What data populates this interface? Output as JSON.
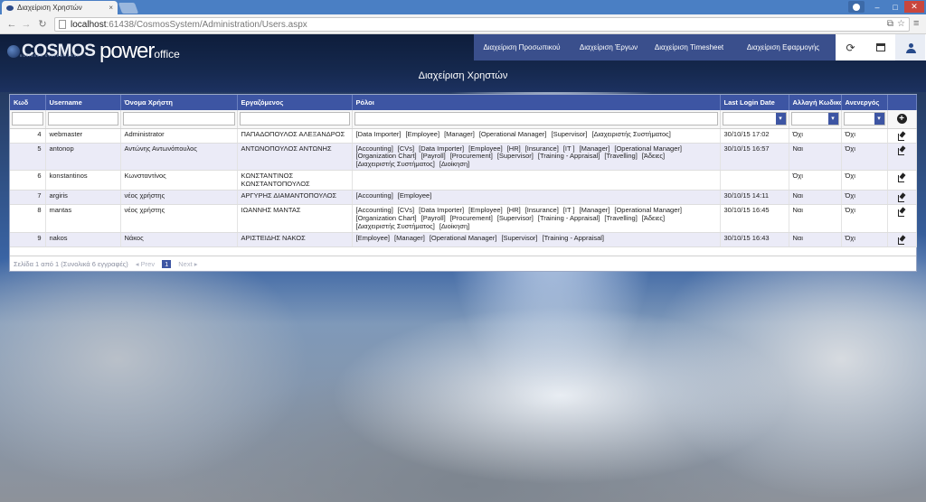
{
  "browser": {
    "tab_title": "Διαχείριση Χρηστών",
    "tab_close": "×",
    "url_host": "localhost",
    "url_rest": ":61438/CosmosSystem/Administration/Users.aspx",
    "win_min": "–",
    "win_max": "□",
    "win_close": "✕",
    "nav_back": "←",
    "nav_forward": "→",
    "nav_reload": "↻",
    "translate": "⧉",
    "star": "☆",
    "menu": "≡"
  },
  "brand": {
    "cosmos": "COSMOS",
    "cosmos_sub": "BUSINESS SYSTEMS AEBE",
    "power": "power",
    "office": "office"
  },
  "nav": {
    "items": [
      {
        "label": "Διαχείριση Προσωπικού"
      },
      {
        "label": "Διαχείριση Έργων"
      },
      {
        "label": "Διαχείριση Timesheet"
      },
      {
        "label": "Διαχείριση Εφαρμογής"
      }
    ],
    "refresh_icon": "⟳"
  },
  "page": {
    "title": "Διαχείριση Χρηστών"
  },
  "grid": {
    "columns": {
      "id": "Κωδ",
      "username": "Username",
      "display_name": "Όνομα Χρήστη",
      "employee": "Εργαζόμενος",
      "roles": "Ρόλοι",
      "last_login": "Last Login Date",
      "change_password": "Αλλαγή Κωδικού",
      "inactive": "Ανενεργός"
    },
    "add_icon": "+",
    "filter_arrow": "▾",
    "rows": [
      {
        "id": "4",
        "username": "webmaster",
        "name": "Administrator",
        "employee": "ΠΑΠΑΔΟΠΟΥΛΟΣ ΑΛΕΞΑΝΔΡΟΣ",
        "roles": [
          "[Data Importer]",
          "[Employee]",
          "[Manager]",
          "[Operational Manager]",
          "[Supervisor]",
          "[Διαχειριστής Συστήματος]"
        ],
        "last_login": "30/10/15 17:02",
        "change_password": "Όχι",
        "inactive": "Όχι"
      },
      {
        "id": "5",
        "username": "antonop",
        "name": "Αντώνης Αντωνόπουλος",
        "employee": "ΑΝΤΩΝΟΠΟΥΛΟΣ ΑΝΤΩΝΗΣ",
        "roles": [
          "[Accounting]",
          "[CVs]",
          "[Data Importer]",
          "[Employee]",
          "[HR]",
          "[Insurance]",
          "[IT ]",
          "[Manager]",
          "[Operational Manager]",
          "[Organization Chart]",
          "[Payroll]",
          "[Procurement]",
          "[Supervisor]",
          "[Training - Appraisal]",
          "[Travelling]",
          "[Άδειες]",
          "[Διαχειριστής Συστήματος]",
          "[Διοίκηση]"
        ],
        "last_login": "30/10/15 16:57",
        "change_password": "Ναι",
        "inactive": "Όχι"
      },
      {
        "id": "6",
        "username": "konstantinos",
        "name": "Κωνσταντίνος",
        "employee": "ΚΩΝΣΤΑΝΤΙΝΟΣ ΚΩΝΣΤΑΝΤΟΠΟΥΛΟΣ",
        "roles": [],
        "last_login": "",
        "change_password": "Όχι",
        "inactive": "Όχι"
      },
      {
        "id": "7",
        "username": "argiris",
        "name": "νέος χρήστης",
        "employee": "ΑΡΓΥΡΗΣ ΔΙΑΜΑΝΤΟΠΟΥΛΟΣ",
        "roles": [
          "[Accounting]",
          "[Employee]"
        ],
        "last_login": "30/10/15 14:11",
        "change_password": "Ναι",
        "inactive": "Όχι"
      },
      {
        "id": "8",
        "username": "mantas",
        "name": "νέος χρήστης",
        "employee": "ΙΩΑΝΝΗΣ ΜΑΝΤΑΣ",
        "roles": [
          "[Accounting]",
          "[CVs]",
          "[Data Importer]",
          "[Employee]",
          "[HR]",
          "[Insurance]",
          "[IT ]",
          "[Manager]",
          "[Operational Manager]",
          "[Organization Chart]",
          "[Payroll]",
          "[Procurement]",
          "[Supervisor]",
          "[Training - Appraisal]",
          "[Travelling]",
          "[Άδειες]",
          "[Διαχειριστής Συστήματος]",
          "[Διοίκηση]"
        ],
        "last_login": "30/10/15 16:45",
        "change_password": "Ναι",
        "inactive": "Όχι"
      },
      {
        "id": "9",
        "username": "nakos",
        "name": "Νάκος",
        "employee": "ΑΡΙΣΤΕΙΔΗΣ ΝΑΚΟΣ",
        "roles": [
          "[Employee]",
          "[Manager]",
          "[Operational Manager]",
          "[Supervisor]",
          "[Training - Appraisal]"
        ],
        "last_login": "30/10/15 16:43",
        "change_password": "Ναι",
        "inactive": "Όχι"
      }
    ]
  },
  "pager": {
    "summary": "Σελίδα 1 από 1 (Συνολικά 6 εγγραφές)",
    "prev": "◂ Prev",
    "current": "1",
    "next": "Next ▸"
  },
  "colors": {
    "header": "#3d55a3",
    "nav_bg": "#3a4f8c",
    "topbar": "#15284d",
    "alt_row": "#ebebf7"
  }
}
